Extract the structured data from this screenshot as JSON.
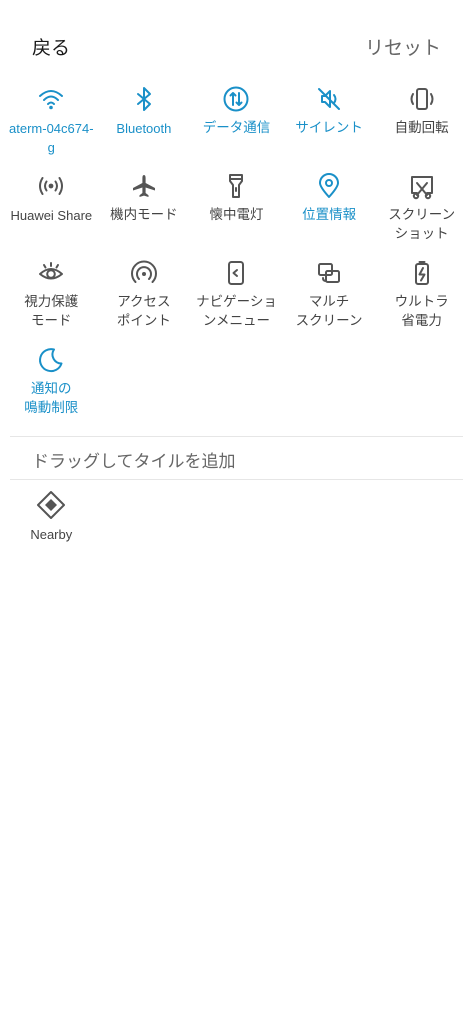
{
  "header": {
    "back_label": "戻る",
    "reset_label": "リセット"
  },
  "colors": {
    "active": "#1a90c8",
    "inactive": "#555555"
  },
  "tiles": [
    {
      "label": "aterm-04c674-\ng",
      "icon": "wifi-icon",
      "active": true
    },
    {
      "label": "Bluetooth",
      "icon": "bluetooth-icon",
      "active": true
    },
    {
      "label": "データ通信",
      "icon": "mobile-data-icon",
      "active": true
    },
    {
      "label": "サイレント",
      "icon": "silent-icon",
      "active": true
    },
    {
      "label": "自動回転",
      "icon": "auto-rotate-icon",
      "active": false
    },
    {
      "label": "Huawei Share",
      "icon": "huawei-share-icon",
      "active": false
    },
    {
      "label": "機内モード",
      "icon": "airplane-icon",
      "active": false
    },
    {
      "label": "懐中電灯",
      "icon": "flashlight-icon",
      "active": false
    },
    {
      "label": "位置情報",
      "icon": "location-icon",
      "active": true
    },
    {
      "label": "スクリーン\nショット",
      "icon": "screenshot-icon",
      "active": false
    },
    {
      "label": "視力保護\nモード",
      "icon": "eye-comfort-icon",
      "active": false
    },
    {
      "label": "アクセス\nポイント",
      "icon": "hotspot-icon",
      "active": false
    },
    {
      "label": "ナビゲーショ\nンメニュー",
      "icon": "navigation-icon",
      "active": false
    },
    {
      "label": "マルチ\nスクリーン",
      "icon": "multi-screen-icon",
      "active": false
    },
    {
      "label": "ウルトラ\n省電力",
      "icon": "ultra-power-icon",
      "active": false
    },
    {
      "label": "通知の\n鳴動制限",
      "icon": "do-not-disturb-icon",
      "active": true
    }
  ],
  "add_section": {
    "title": "ドラッグしてタイルを追加",
    "tiles": [
      {
        "label": "Nearby",
        "icon": "nearby-icon",
        "active": false
      }
    ]
  }
}
